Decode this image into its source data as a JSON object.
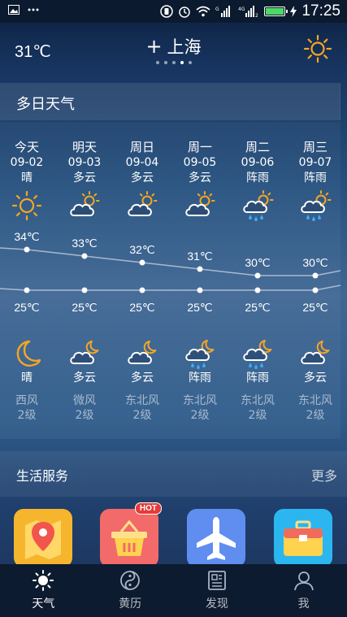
{
  "status_bar": {
    "time": "17:25",
    "network": "4G"
  },
  "header": {
    "current_temp": "31℃",
    "add_symbol": "+",
    "city": "上海",
    "page_count": 5,
    "active_page": 3
  },
  "forecast_title": "多日天气",
  "days": [
    {
      "label": "今天",
      "date": "09-02",
      "day_weather": "晴",
      "day_icon": "sun-icon",
      "high": "34℃",
      "low": "25℃",
      "night_weather": "晴",
      "night_icon": "moon-icon",
      "wind": "西风",
      "wind_level": "2级"
    },
    {
      "label": "明天",
      "date": "09-03",
      "day_weather": "多云",
      "day_icon": "partly-cloudy-icon",
      "high": "33℃",
      "low": "25℃",
      "night_weather": "多云",
      "night_icon": "cloudy-night-icon",
      "wind": "微风",
      "wind_level": "2级"
    },
    {
      "label": "周日",
      "date": "09-04",
      "day_weather": "多云",
      "day_icon": "partly-cloudy-icon",
      "high": "32℃",
      "low": "25℃",
      "night_weather": "多云",
      "night_icon": "cloudy-night-icon",
      "wind": "东北风",
      "wind_level": "2级"
    },
    {
      "label": "周一",
      "date": "09-05",
      "day_weather": "多云",
      "day_icon": "partly-cloudy-icon",
      "high": "31℃",
      "low": "25℃",
      "night_weather": "阵雨",
      "night_icon": "shower-night-icon",
      "wind": "东北风",
      "wind_level": "2级"
    },
    {
      "label": "周二",
      "date": "09-06",
      "day_weather": "阵雨",
      "day_icon": "shower-icon",
      "high": "30℃",
      "low": "25℃",
      "night_weather": "阵雨",
      "night_icon": "shower-night-icon",
      "wind": "东北风",
      "wind_level": "2级"
    },
    {
      "label": "周三",
      "date": "09-07",
      "day_weather": "阵雨",
      "day_icon": "shower-icon",
      "high": "30℃",
      "low": "25℃",
      "night_weather": "多云",
      "night_icon": "cloudy-night-icon",
      "wind": "东北风",
      "wind_level": "2级"
    }
  ],
  "chart_data": {
    "type": "line",
    "categories": [
      "09-02",
      "09-03",
      "09-04",
      "09-05",
      "09-06",
      "09-07"
    ],
    "series": [
      {
        "values": [
          34,
          33,
          32,
          31,
          30,
          30
        ]
      },
      {
        "values": [
          25,
          25,
          25,
          25,
          25,
          25
        ]
      }
    ]
  },
  "life": {
    "title": "生活服务",
    "more": "更多",
    "hot_badge": "HOT",
    "items": [
      {
        "icon": "map-pin-icon",
        "color": "#f5b62e"
      },
      {
        "icon": "shopping-basket-icon",
        "color": "#f26a6a"
      },
      {
        "icon": "airplane-icon",
        "color": "#5f8df0"
      },
      {
        "icon": "briefcase-icon",
        "color": "#2bb6f0"
      }
    ]
  },
  "tabs": [
    {
      "label": "天气",
      "icon": "sun-icon",
      "active": true
    },
    {
      "label": "黄历",
      "icon": "yin-yang-icon",
      "active": false
    },
    {
      "label": "发现",
      "icon": "news-icon",
      "active": false
    },
    {
      "label": "我",
      "icon": "user-icon",
      "active": false
    }
  ],
  "colors": {
    "sun": "#f5a623",
    "moon": "#f5a623",
    "rain": "#3fa9f5"
  }
}
